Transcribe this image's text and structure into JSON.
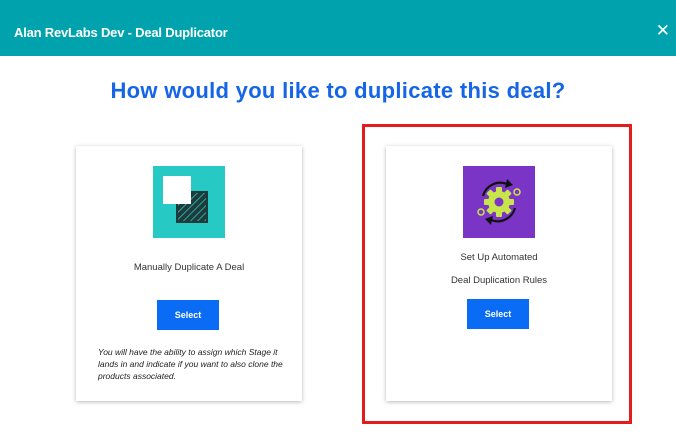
{
  "header": {
    "title": "Alan RevLabs Dev - Deal Duplicator",
    "close_glyph": "✕"
  },
  "heading": "How would you like to duplicate this deal?",
  "cards": [
    {
      "label": "Manually Duplicate A Deal",
      "button_label": "Select",
      "note": "You will have the ability to assign which Stage it lands in and indicate if you want to also clone the products associated.",
      "icon": "duplicate-icon"
    },
    {
      "label_line1": "Set Up Automated",
      "label_line2": "Deal Duplication Rules",
      "button_label": "Select",
      "icon": "automation-gear-icon"
    }
  ],
  "colors": {
    "header": "#00a3ad",
    "heading": "#1565e6",
    "button": "#0a6cf5",
    "highlight": "#e31c1c",
    "icon1_bg": "#26c9c3",
    "icon2_bg": "#7a35c7",
    "gear": "#c8e64a"
  }
}
